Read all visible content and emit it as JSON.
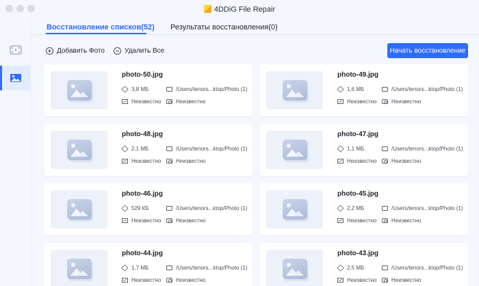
{
  "app": {
    "title": "4DDiG File Repair"
  },
  "tabs": [
    {
      "label": "Восстановление списков(52)"
    },
    {
      "label": "Результаты восстановления(0)"
    }
  ],
  "toolbar": {
    "add_label": "Добавить Фото",
    "delete_label": "Удалить Все",
    "start_label": "Начать восстановление"
  },
  "colors": {
    "accent": "#2f6bff",
    "background": "#f4f7fd",
    "card": "#ffffff"
  },
  "files": [
    {
      "name": "photo-50.jpg",
      "size": "3,8 МБ",
      "path": "/Users/tenors...ktop/Photo (1)",
      "resolution": "Неизвестно",
      "camera": "Неизвестно"
    },
    {
      "name": "photo-49.jpg",
      "size": "1,6 МБ",
      "path": "/Users/tenors...ktop/Photo (1)",
      "resolution": "Неизвестно",
      "camera": "Неизвестно"
    },
    {
      "name": "photo-48.jpg",
      "size": "2,1 МБ",
      "path": "/Users/tenors...ktop/Photo (1)",
      "resolution": "Неизвестно",
      "camera": "Неизвестно"
    },
    {
      "name": "photo-47.jpg",
      "size": "1,1 МБ",
      "path": "/Users/tenors...ktop/Photo (1)",
      "resolution": "Неизвестно",
      "camera": "Неизвестно"
    },
    {
      "name": "photo-46.jpg",
      "size": "529 КБ",
      "path": "/Users/tenors...ktop/Photo (1)",
      "resolution": "Неизвестно",
      "camera": "Неизвестно"
    },
    {
      "name": "photo-45.jpg",
      "size": "2,2 МБ",
      "path": "/Users/tenors...ktop/Photo (1)",
      "resolution": "Неизвестно",
      "camera": "Неизвестно"
    },
    {
      "name": "photo-44.jpg",
      "size": "1,7 МБ",
      "path": "/Users/tenors...ktop/Photo (1)",
      "resolution": "Неизвестно",
      "camera": "Неизвестно"
    },
    {
      "name": "photo-43.jpg",
      "size": "2,5 МБ",
      "path": "/Users/tenors...ktop/Photo (1)",
      "resolution": "Неизвестно",
      "camera": "Неизвестно"
    }
  ]
}
